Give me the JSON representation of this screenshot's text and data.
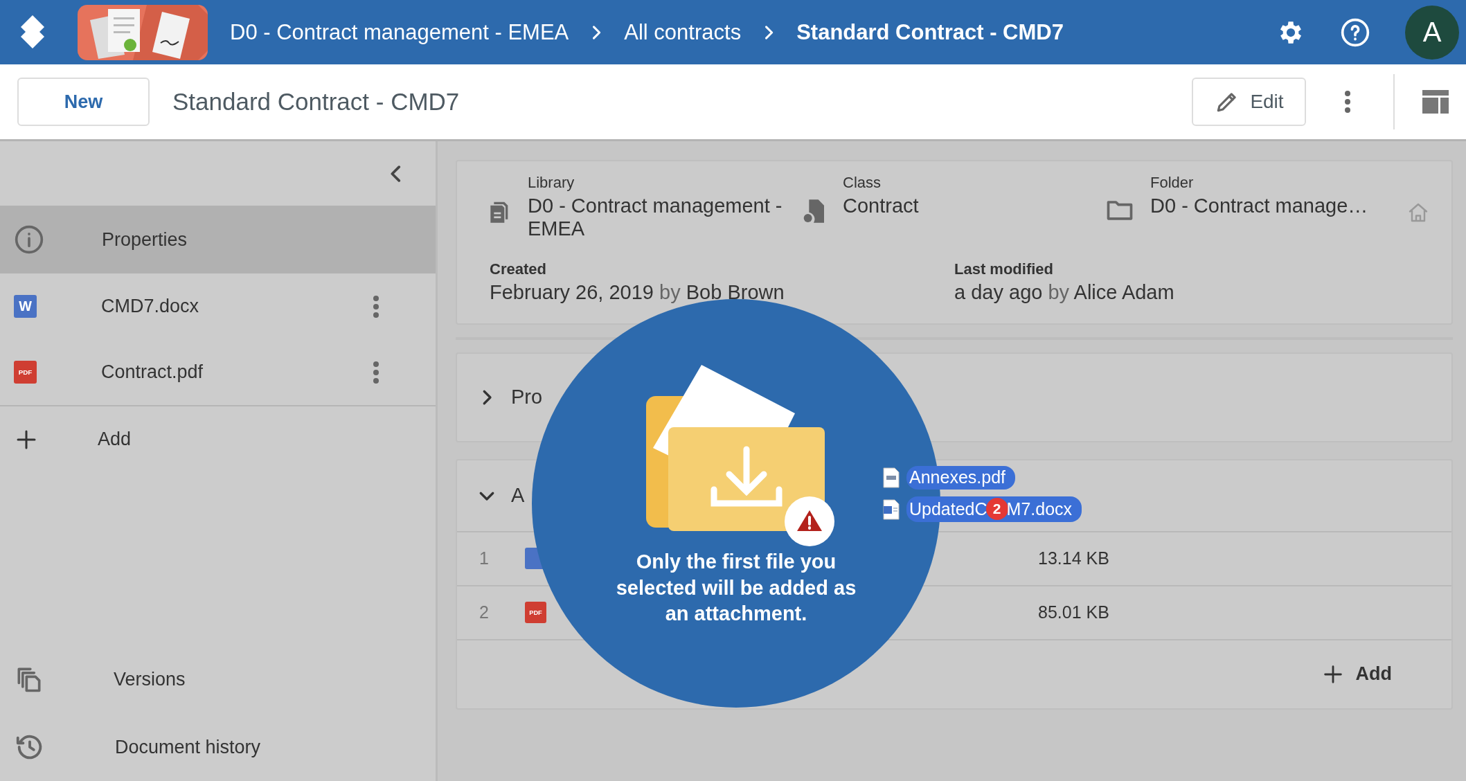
{
  "header": {
    "breadcrumbs": [
      {
        "label": "D0 - Contract management - EMEA",
        "current": false
      },
      {
        "label": "All contracts",
        "current": false
      },
      {
        "label": "Standard Contract - CMD7",
        "current": true
      }
    ],
    "avatar": "A"
  },
  "toolbar": {
    "new_button": "New",
    "title": "Standard Contract - CMD7",
    "edit_button": "Edit"
  },
  "sidebar": {
    "items": [
      {
        "kind": "properties",
        "label": "Properties",
        "selected": true
      },
      {
        "kind": "word",
        "icon_text": "W",
        "label": "CMD7.docx",
        "selected": false
      },
      {
        "kind": "pdf",
        "icon_text": "PDF",
        "label": "Contract.pdf",
        "selected": false
      },
      {
        "kind": "add",
        "label": "Add",
        "selected": false
      }
    ],
    "bottom_items": [
      {
        "kind": "versions",
        "label": "Versions"
      },
      {
        "kind": "history",
        "label": "Document history"
      }
    ]
  },
  "summary": {
    "fields": [
      {
        "kind": "library",
        "label": "Library",
        "value": "D0 - Contract management - EMEA"
      },
      {
        "kind": "class",
        "label": "Class",
        "value": "Contract"
      },
      {
        "kind": "folder",
        "label": "Folder",
        "value": "D0 - Contract manage…"
      }
    ],
    "created": {
      "label": "Created",
      "date": "February 26, 2019",
      "by": "by",
      "user": "Bob Brown"
    },
    "modified": {
      "label": "Last modified",
      "date": "a day ago",
      "by": "by",
      "user": "Alice Adam"
    }
  },
  "sections": [
    {
      "title": "Pro",
      "expanded": false
    },
    {
      "title": "A",
      "expanded": true,
      "rows": [
        {
          "index": "1",
          "kind": "word",
          "size": "13.14 KB"
        },
        {
          "index": "2",
          "kind": "pdf",
          "icon_text": "PDF",
          "size": "85.01 KB"
        }
      ],
      "add": "Add"
    }
  ],
  "drop_overlay": {
    "message": "Only the first file you selected will be added as an attachment.",
    "dragged_files": [
      {
        "kind": "pdf",
        "name_before": "Annexes.pdf"
      },
      {
        "kind": "word",
        "name_before": "UpdatedC",
        "count": "2",
        "name_after": "M7.docx"
      }
    ]
  }
}
